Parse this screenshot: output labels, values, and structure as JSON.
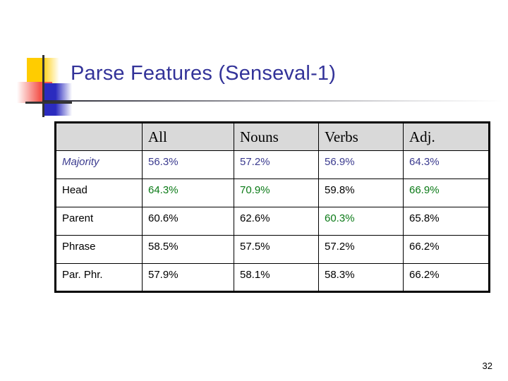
{
  "slide": {
    "title": "Parse Features (Senseval-1)",
    "page_number": "32",
    "title_color": "#333399",
    "logo": {
      "yellow": "#FFCC00",
      "red": "#F4564E",
      "blue": "#2B2BBF",
      "line": "#333333"
    }
  },
  "table": {
    "header_bg": "#D9D9D9",
    "headers": [
      "",
      "All",
      "Nouns",
      "Verbs",
      "Adj."
    ],
    "rows": [
      {
        "label": "Majority",
        "label_style": "italic-navy",
        "cells": [
          {
            "text": "56.3%",
            "color": "navy"
          },
          {
            "text": "57.2%",
            "color": "navy"
          },
          {
            "text": "56.9%",
            "color": "navy"
          },
          {
            "text": "64.3%",
            "color": "navy"
          }
        ]
      },
      {
        "label": "Head",
        "label_style": "plain",
        "cells": [
          {
            "text": "64.3%",
            "color": "green"
          },
          {
            "text": "70.9%",
            "color": "green"
          },
          {
            "text": "59.8%",
            "color": "black"
          },
          {
            "text": "66.9%",
            "color": "green"
          }
        ]
      },
      {
        "label": "Parent",
        "label_style": "plain",
        "cells": [
          {
            "text": "60.6%",
            "color": "black"
          },
          {
            "text": "62.6%",
            "color": "black"
          },
          {
            "text": "60.3%",
            "color": "green"
          },
          {
            "text": "65.8%",
            "color": "black"
          }
        ]
      },
      {
        "label": "Phrase",
        "label_style": "plain",
        "cells": [
          {
            "text": "58.5%",
            "color": "black"
          },
          {
            "text": "57.5%",
            "color": "black"
          },
          {
            "text": "57.2%",
            "color": "black"
          },
          {
            "text": "66.2%",
            "color": "black"
          }
        ]
      },
      {
        "label": "Par. Phr.",
        "label_style": "plain",
        "cells": [
          {
            "text": "57.9%",
            "color": "black"
          },
          {
            "text": "58.1%",
            "color": "black"
          },
          {
            "text": "58.3%",
            "color": "black"
          },
          {
            "text": "66.2%",
            "color": "black"
          }
        ]
      }
    ]
  }
}
